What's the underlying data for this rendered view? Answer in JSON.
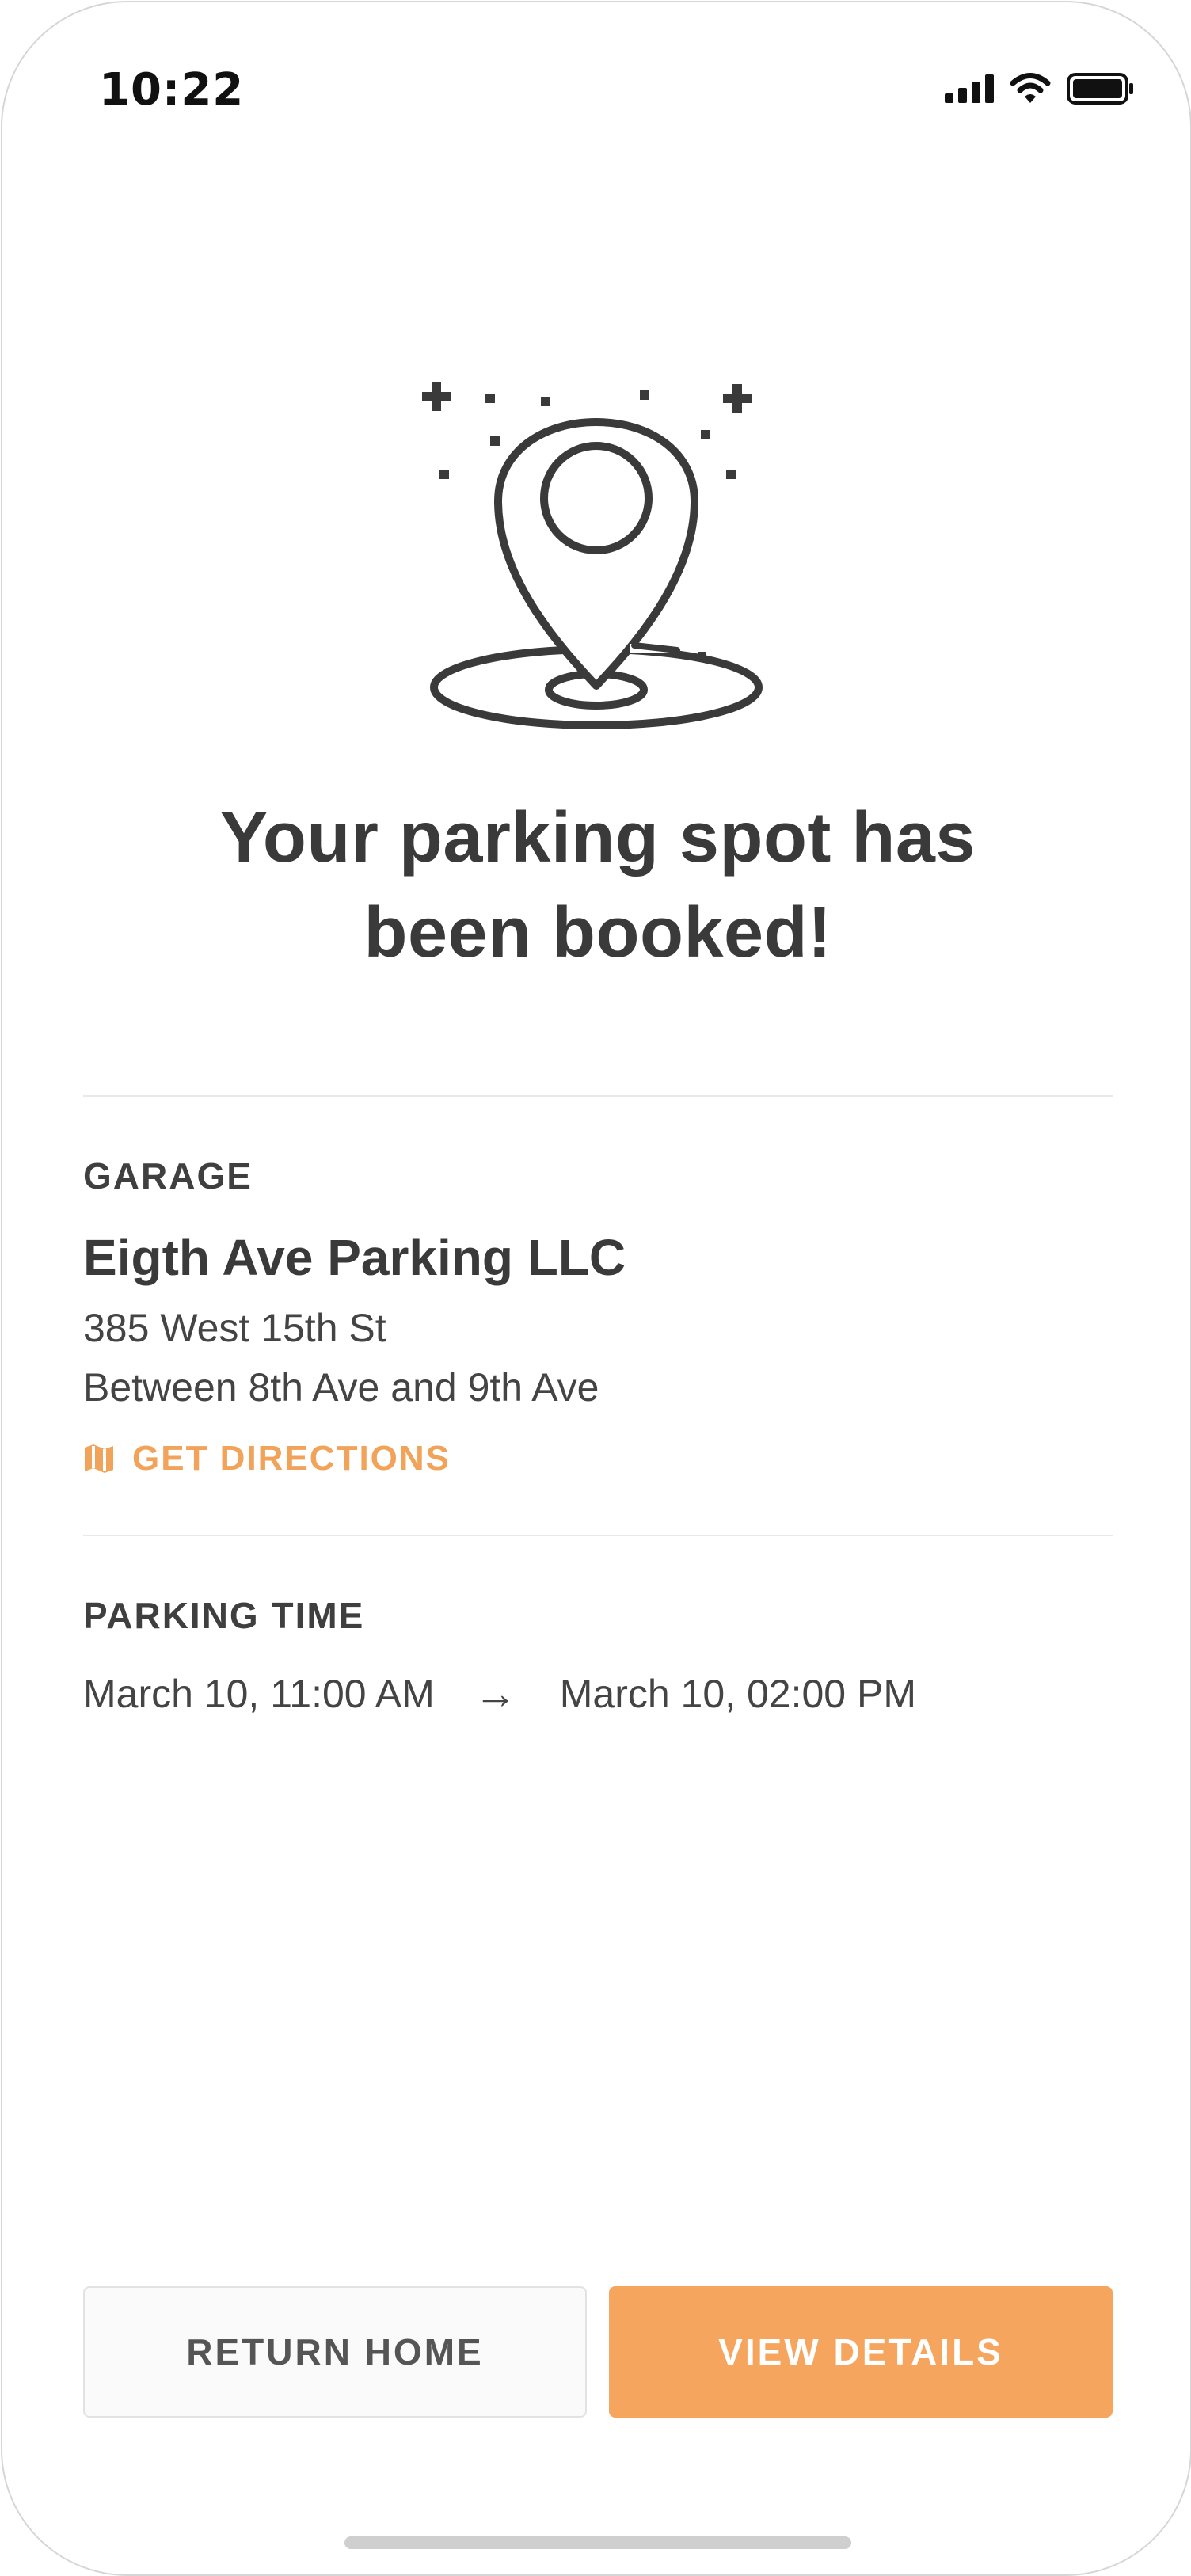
{
  "status_bar": {
    "time": "10:22",
    "icons": [
      "cellular-signal-icon",
      "wifi-icon",
      "battery-icon"
    ]
  },
  "confirmation": {
    "illustration": "map-pin-location-icon",
    "headline_line1": "Your parking spot has",
    "headline_line2": "been booked!"
  },
  "garage": {
    "section_label": "GARAGE",
    "name": "Eigth Ave Parking LLC",
    "address_line1": "385 West 15th St",
    "address_line2": "Between 8th Ave and 9th Ave",
    "directions_label": "GET DIRECTIONS",
    "directions_icon": "map-icon"
  },
  "parking_time": {
    "section_label": "PARKING TIME",
    "start": "March 10, 11:00 AM",
    "arrow": "→",
    "end": "March 10, 02:00 PM"
  },
  "actions": {
    "return_home_label": "RETURN HOME",
    "view_details_label": "VIEW DETAILS"
  },
  "colors": {
    "accent": "#F5A55E",
    "text": "#3A3A3A",
    "divider": "#E8E8E8"
  }
}
